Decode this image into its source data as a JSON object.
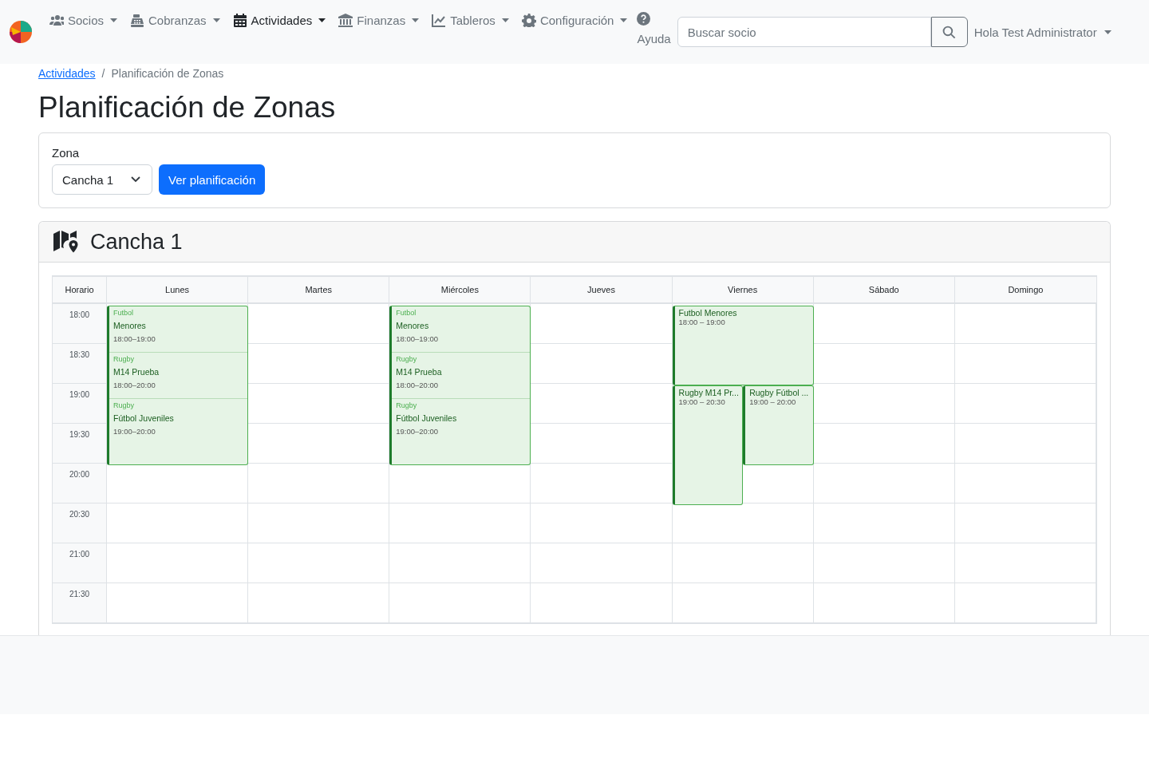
{
  "navbar": {
    "items": [
      {
        "label": "Socios",
        "selected": false
      },
      {
        "label": "Cobranzas",
        "selected": false
      },
      {
        "label": "Actividades",
        "selected": true
      },
      {
        "label": "Finanzas",
        "selected": false
      },
      {
        "label": "Tableros",
        "selected": false
      },
      {
        "label": "Configuración",
        "selected": false
      }
    ],
    "help": {
      "label": "Ayuda"
    },
    "search": {
      "placeholder": "Buscar socio"
    },
    "user": {
      "label": "Hola Test Administrator"
    }
  },
  "breadcrumb": {
    "separator": "/",
    "items": [
      {
        "label": "Actividades",
        "kind": "link"
      },
      {
        "label": "Planificación de Zonas",
        "kind": "current"
      }
    ]
  },
  "title": "Planificación de Zonas",
  "filter": {
    "label": "Zona",
    "value": "Cancha 1",
    "button": "Ver planificación"
  },
  "schedule": {
    "title": "Cancha 1",
    "corner": "Horario",
    "slots": [
      "18:00",
      "18:30",
      "19:00",
      "19:30",
      "20:00",
      "20:30",
      "21:00",
      "21:30"
    ],
    "days": [
      {
        "label": "Lunes",
        "blocks": [
          {
            "kind": "stack",
            "entries": [
              {
                "category": "Futbol",
                "name": "Menores",
                "time": "18:00–19:00"
              },
              {
                "category": "Rugby",
                "name": "M14 Prueba",
                "time": "18:00–20:00"
              },
              {
                "category": "Rugby",
                "name": "Fútbol Juveniles",
                "time": "19:00–20:00"
              }
            ]
          }
        ]
      },
      {
        "label": "Martes"
      },
      {
        "label": "Miércoles",
        "blocks": [
          {
            "kind": "stack",
            "entries": [
              {
                "category": "Futbol",
                "name": "Menores",
                "time": "18:00–19:00"
              },
              {
                "category": "Rugby",
                "name": "M14 Prueba",
                "time": "18:00–20:00"
              },
              {
                "category": "Rugby",
                "name": "Fútbol Juveniles",
                "time": "19:00–20:00"
              }
            ]
          }
        ]
      },
      {
        "label": "Jueves"
      },
      {
        "label": "Viernes",
        "blocks": [
          {
            "kind": "event",
            "name": "Futbol Menores",
            "time": "18:00 – 19:00"
          },
          {
            "kind": "event",
            "name": "Rugby M14 Pr...",
            "time": "19:00 – 20:30"
          },
          {
            "kind": "event",
            "name": "Rugby Fútbol ...",
            "time": "19:00 – 20:00"
          }
        ]
      },
      {
        "label": "Sábado"
      },
      {
        "label": "Domingo"
      }
    ]
  }
}
